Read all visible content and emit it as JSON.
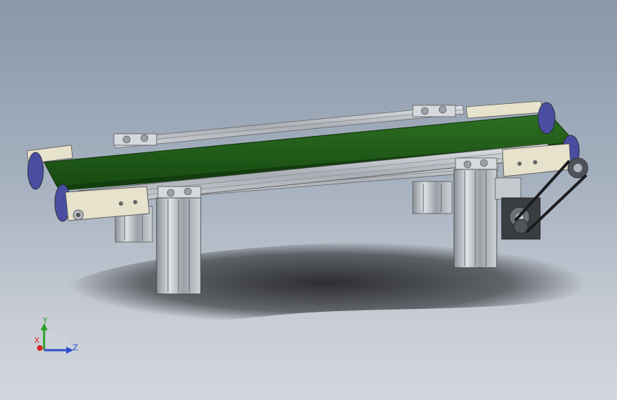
{
  "viewport": {
    "background_top": "#8997a8",
    "background_bottom": "#d3d6dc"
  },
  "model": {
    "belt_color": "#1f5a17",
    "frame_color": "#c9cdd2",
    "roller_color": "#4a4ea0"
  },
  "triad": {
    "x_label": "X",
    "y_label": "Y",
    "z_label": "Z",
    "x_color": "#d8261e",
    "y_color": "#2aa02a",
    "z_color": "#2f4fcf"
  }
}
